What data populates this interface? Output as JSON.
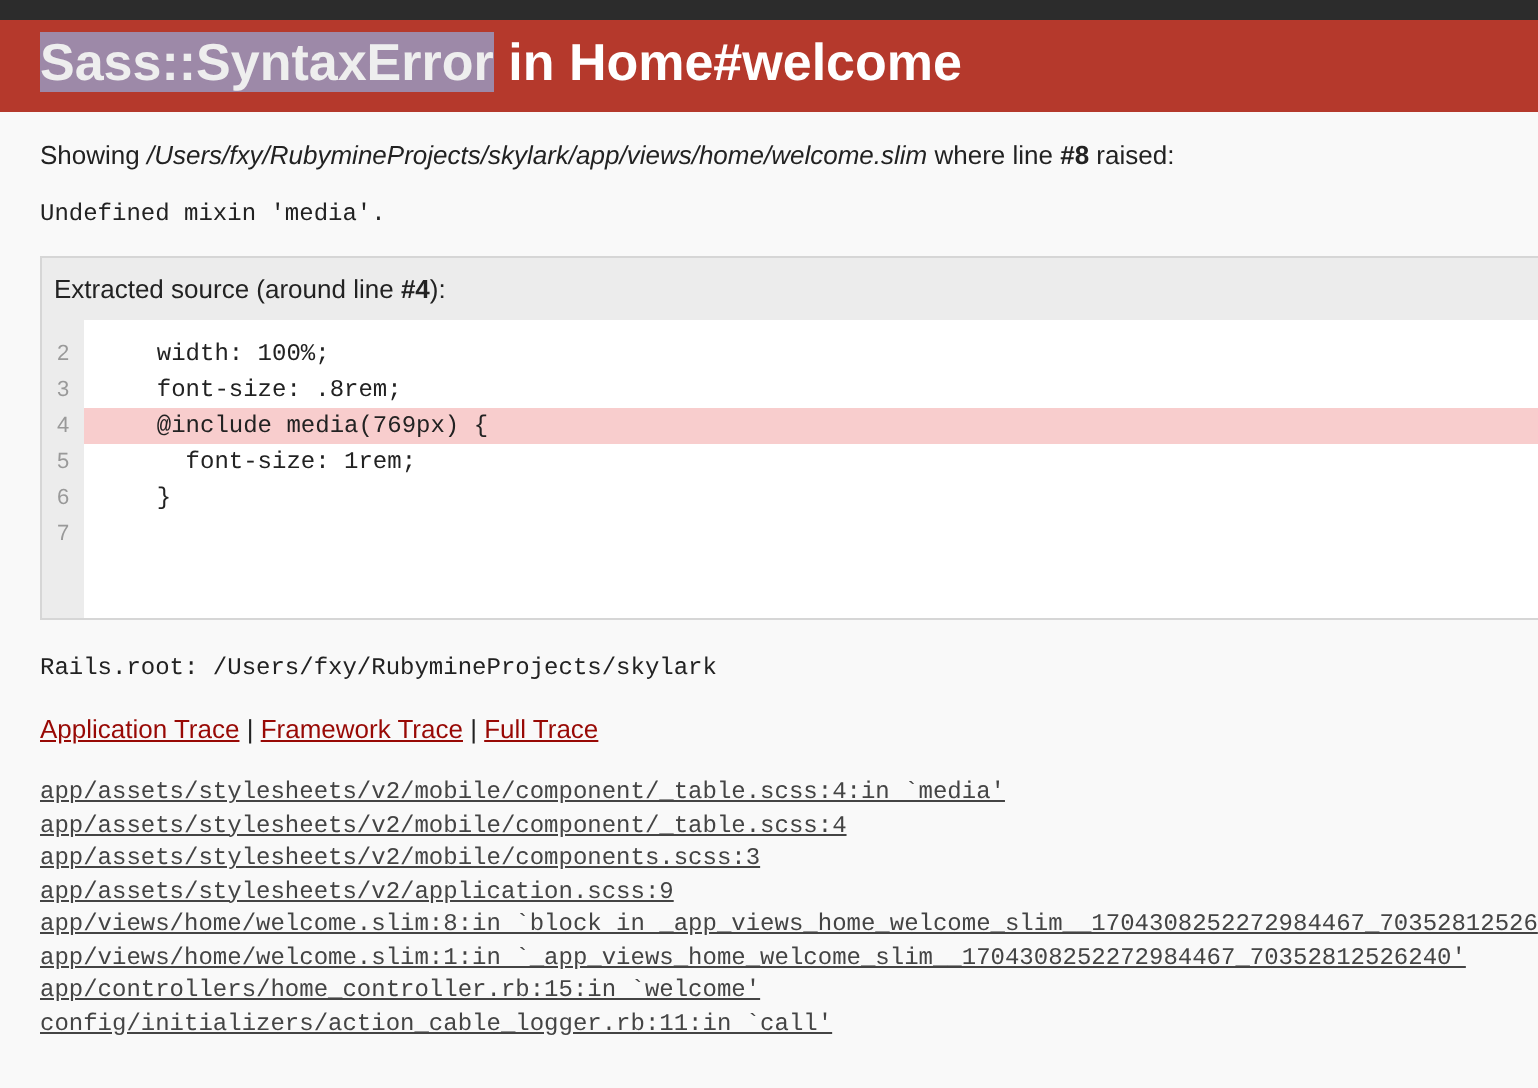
{
  "header": {
    "title_parts": [
      {
        "text": "Sass::SyntaxError",
        "highlighted": true
      },
      {
        "text": " in Home#welcome",
        "highlighted": false
      }
    ]
  },
  "showing": "Showing */Users/fxy/RubymineProjects/skylark/app/views/home/welcome.slim* where line **#8** raised:",
  "message": "Undefined mixin 'media'.",
  "source": {
    "title": "Extracted source (around line **#4**):",
    "lines": [
      {
        "number": "2",
        "code": "  width: 100%;",
        "highlighted": false
      },
      {
        "number": "3",
        "code": "  font-size: .8rem;",
        "highlighted": false
      },
      {
        "number": "4",
        "code": "  @include media(769px) {",
        "highlighted": true
      },
      {
        "number": "5",
        "code": "    font-size: 1rem;",
        "highlighted": false
      },
      {
        "number": "6",
        "code": "  }",
        "highlighted": false
      },
      {
        "number": "7",
        "highlighted": false
      }
    ]
  },
  "rails_root": "Rails.root: /Users/fxy/RubymineProjects/skylark",
  "trace_tabs": [
    {
      "label": "Application Trace"
    },
    {
      "label": "Framework Trace"
    },
    {
      "label": "Full Trace"
    }
  ],
  "trace_separator": "|",
  "trace": [
    "app/assets/stylesheets/v2/mobile/component/_table.scss:4:in `media'",
    "app/assets/stylesheets/v2/mobile/component/_table.scss:4",
    "app/assets/stylesheets/v2/mobile/components.scss:3",
    "app/assets/stylesheets/v2/application.scss:9",
    "app/views/home/welcome.slim:8:in `block in _app_views_home_welcome_slim__1704308252272984467_70352812526",
    "app/views/home/welcome.slim:1:in `_app_views_home_welcome_slim__1704308252272984467_70352812526240'",
    "app/controllers/home_controller.rb:15:in `welcome'",
    "config/initializers/action_cable_logger.rb:11:in `call'"
  ]
}
